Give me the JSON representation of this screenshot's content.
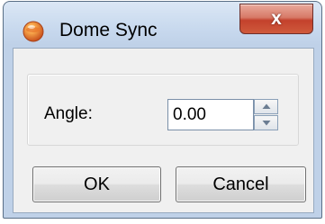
{
  "window": {
    "title": "Dome Sync",
    "icon": "app-orange-orb-icon",
    "close_label": "x"
  },
  "form": {
    "angle_label": "Angle:",
    "angle_value": "0.00"
  },
  "buttons": {
    "ok_label": "OK",
    "cancel_label": "Cancel"
  },
  "colors": {
    "title_bar": "#c8d9ee",
    "close_button": "#c3412c",
    "client_background": "#f0f0f0"
  }
}
